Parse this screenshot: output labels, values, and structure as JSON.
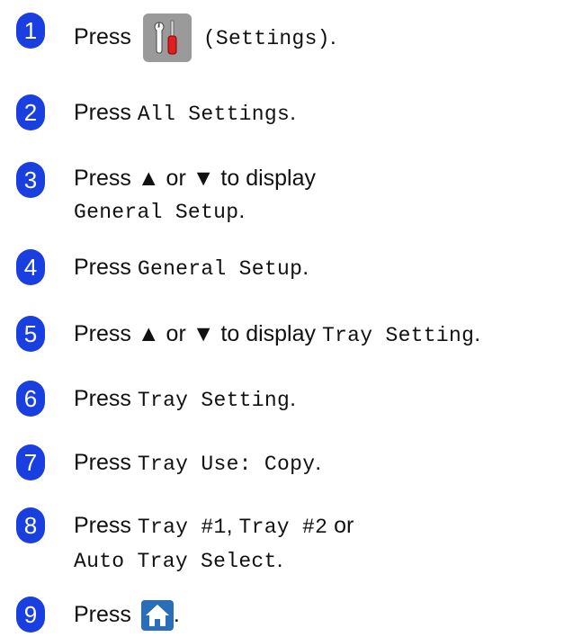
{
  "steps": [
    {
      "num": "1",
      "parts": [
        {
          "t": "Press"
        },
        {
          "icon": "settings"
        },
        {
          "m": "(Settings)"
        },
        {
          "t": "."
        }
      ]
    },
    {
      "num": "2",
      "parts": [
        {
          "t": "Press "
        },
        {
          "m": "All Settings"
        },
        {
          "t": "."
        }
      ]
    },
    {
      "num": "3",
      "parts": [
        {
          "t": "Press ▲ or ▼ to display"
        }
      ],
      "line2": [
        {
          "m": "General Setup"
        },
        {
          "t": "."
        }
      ]
    },
    {
      "num": "4",
      "parts": [
        {
          "t": "Press "
        },
        {
          "m": "General Setup"
        },
        {
          "t": "."
        }
      ]
    },
    {
      "num": "5",
      "parts": [
        {
          "t": "Press ▲ or ▼ to display "
        },
        {
          "m": "Tray Setting"
        },
        {
          "t": "."
        }
      ]
    },
    {
      "num": "6",
      "parts": [
        {
          "t": "Press "
        },
        {
          "m": "Tray Setting"
        },
        {
          "t": "."
        }
      ]
    },
    {
      "num": "7",
      "parts": [
        {
          "t": "Press "
        },
        {
          "m": "Tray Use: Copy"
        },
        {
          "t": "."
        }
      ]
    },
    {
      "num": "8",
      "parts": [
        {
          "t": "Press "
        },
        {
          "m": "Tray #1"
        },
        {
          "t": ", "
        },
        {
          "m": "Tray #2"
        },
        {
          "t": " or"
        }
      ],
      "line2": [
        {
          "m": "Auto Tray Select"
        },
        {
          "t": "."
        }
      ]
    },
    {
      "num": "9",
      "parts": [
        {
          "t": "Press"
        },
        {
          "icon": "home"
        },
        {
          "t": "."
        }
      ]
    }
  ],
  "icons": {
    "settings": "settings-icon",
    "home": "home-icon"
  },
  "colors": {
    "badge": "#1a3fe0",
    "settings_icon_bg": "#9a9a9a",
    "home_icon_bg": "#2a6db8"
  }
}
